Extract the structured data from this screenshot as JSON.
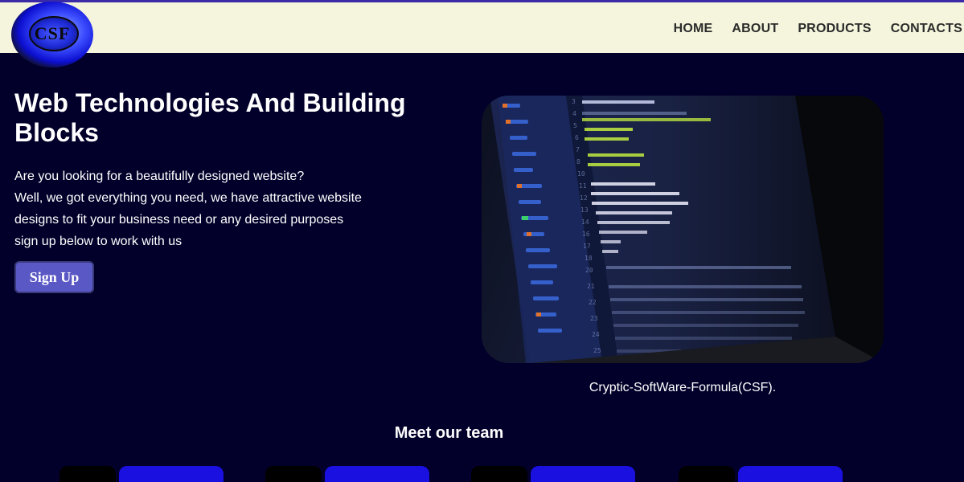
{
  "header": {
    "logo_text": "CSF",
    "nav": [
      {
        "label": "HOME"
      },
      {
        "label": "ABOUT"
      },
      {
        "label": "PRODUCTS"
      },
      {
        "label": "CONTACTS"
      }
    ]
  },
  "hero": {
    "title": "Web Technologies And Building Blocks",
    "lines": [
      "Are you looking for a beautifully designed website?",
      "Well, we got everything you need, we have attractive website",
      "designs to fit your business need or any desired purposes",
      "sign up below to work with us"
    ],
    "signup_label": "Sign Up"
  },
  "image": {
    "caption": "Cryptic-SoftWare-Formula(CSF)."
  },
  "team": {
    "title": "Meet our team"
  },
  "colors": {
    "background": "#02002a",
    "header_bg": "#f5f4dc",
    "button": "#5a58c4",
    "accent_blue": "#1a10e0"
  }
}
